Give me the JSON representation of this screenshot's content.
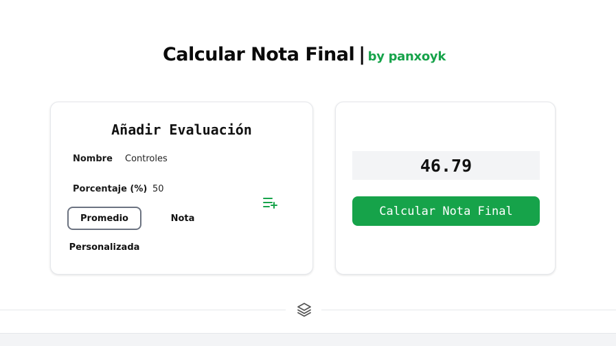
{
  "header": {
    "title": "Calcular Nota Final",
    "separator": "|",
    "byline": "by panxoyk"
  },
  "form": {
    "title": "Añadir Evaluación",
    "name_label": "Nombre",
    "name_value": "Controles",
    "percent_label": "Porcentaje (%)",
    "percent_value": "50",
    "type_options": [
      "Promedio",
      "Nota",
      "Personalizada"
    ],
    "selected_type": "Promedio",
    "add_icon": "list-plus-icon"
  },
  "result": {
    "value": "46.79",
    "button_label": "Calcular Nota Final"
  },
  "footer": {
    "icon": "layers-icon"
  },
  "colors": {
    "accent": "#16a34a",
    "result_bg": "#f3f4f6",
    "border": "#e5e7eb"
  }
}
